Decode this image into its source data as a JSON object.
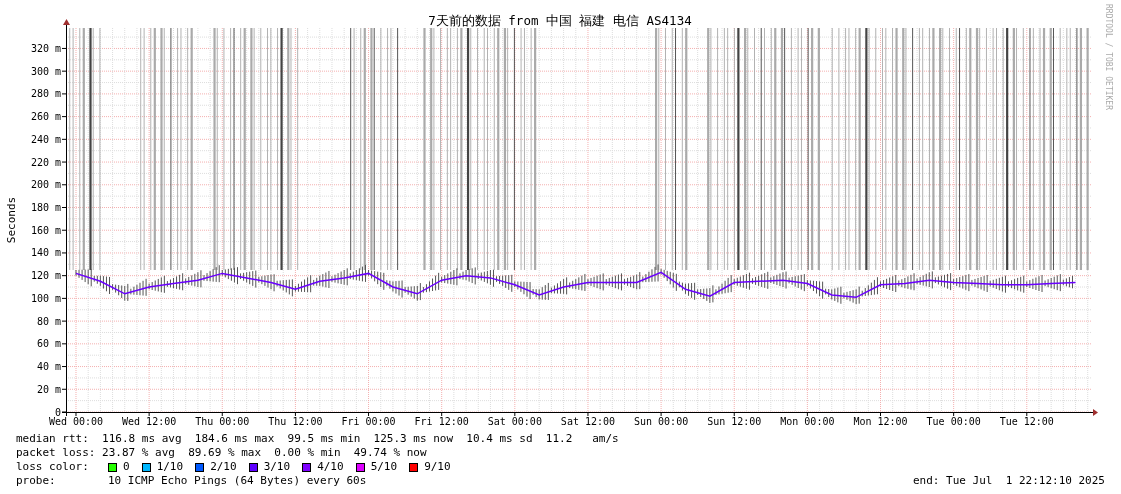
{
  "chart": {
    "chart_data": {
      "type": "line",
      "title": "7天前的数据 from 中国 福建 电信 AS4134",
      "ylabel": "Seconds",
      "categories": [
        "Wed 00:00",
        null,
        null,
        "Wed 12:00",
        null,
        null,
        "Thu 00:00",
        null,
        null,
        "Thu 12:00",
        null,
        null,
        "Fri 00:00",
        null,
        null,
        "Fri 12:00",
        null,
        null,
        "Sat 00:00",
        null,
        null,
        "Sat 12:00",
        null,
        null,
        "Sun 00:00",
        null,
        null,
        "Sun 12:00",
        null,
        null,
        "Mon 00:00",
        null,
        null,
        "Mon 12:00",
        null,
        null,
        "Tue 00:00",
        null,
        null,
        "Tue 12:00",
        null,
        null
      ],
      "values": [
        122,
        115,
        104,
        110,
        113,
        116,
        122,
        118,
        114,
        108,
        115,
        118,
        122,
        110,
        104,
        116,
        120,
        118,
        112,
        103,
        110,
        114,
        114,
        114,
        123,
        108,
        102,
        114,
        115,
        116,
        113,
        103,
        101,
        112,
        113,
        116,
        114,
        113,
        112,
        112,
        113,
        114
      ],
      "ylim": [
        0,
        338
      ],
      "grid": true,
      "yticks": [
        {
          "value": 0,
          "label": "0"
        },
        {
          "value": 20,
          "label": "20 m"
        },
        {
          "value": 40,
          "label": "40 m"
        },
        {
          "value": 60,
          "label": "60 m"
        },
        {
          "value": 80,
          "label": "80 m"
        },
        {
          "value": 100,
          "label": "100 m"
        },
        {
          "value": 120,
          "label": "120 m"
        },
        {
          "value": 140,
          "label": "140 m"
        },
        {
          "value": 160,
          "label": "160 m"
        },
        {
          "value": 180,
          "label": "180 m"
        },
        {
          "value": 200,
          "label": "200 m"
        },
        {
          "value": 220,
          "label": "220 m"
        },
        {
          "value": 240,
          "label": "240 m"
        },
        {
          "value": 260,
          "label": "260 m"
        },
        {
          "value": 280,
          "label": "280 m"
        },
        {
          "value": 300,
          "label": "300 m"
        },
        {
          "value": 320,
          "label": "320 m"
        }
      ]
    },
    "side_label": "RRDTOOL / TOBI OETIKER"
  },
  "legend": {
    "median_rtt": "median rtt:  116.8 ms avg  184.6 ms max  99.5 ms min  125.3 ms now  10.4 ms sd  11.2   am/s",
    "packet_loss": "packet loss: 23.87 % avg  89.69 % max  0.00 % min  49.74 % now",
    "loss_color_label": "loss color:",
    "loss_colors": [
      {
        "label": "0",
        "color": "#26ff00"
      },
      {
        "label": "1/10",
        "color": "#00b8ff"
      },
      {
        "label": "2/10",
        "color": "#0059ff"
      },
      {
        "label": "3/10",
        "color": "#5e00ff"
      },
      {
        "label": "4/10",
        "color": "#7e00ff"
      },
      {
        "label": "5/10",
        "color": "#dd00ff"
      },
      {
        "label": "9/10",
        "color": "#ff0000"
      }
    ],
    "probe_label": "probe:",
    "probe": "10 ICMP Echo Pings (64 Bytes) every 60s",
    "end": "end: Tue Jul  1 22:12:10 2025"
  }
}
